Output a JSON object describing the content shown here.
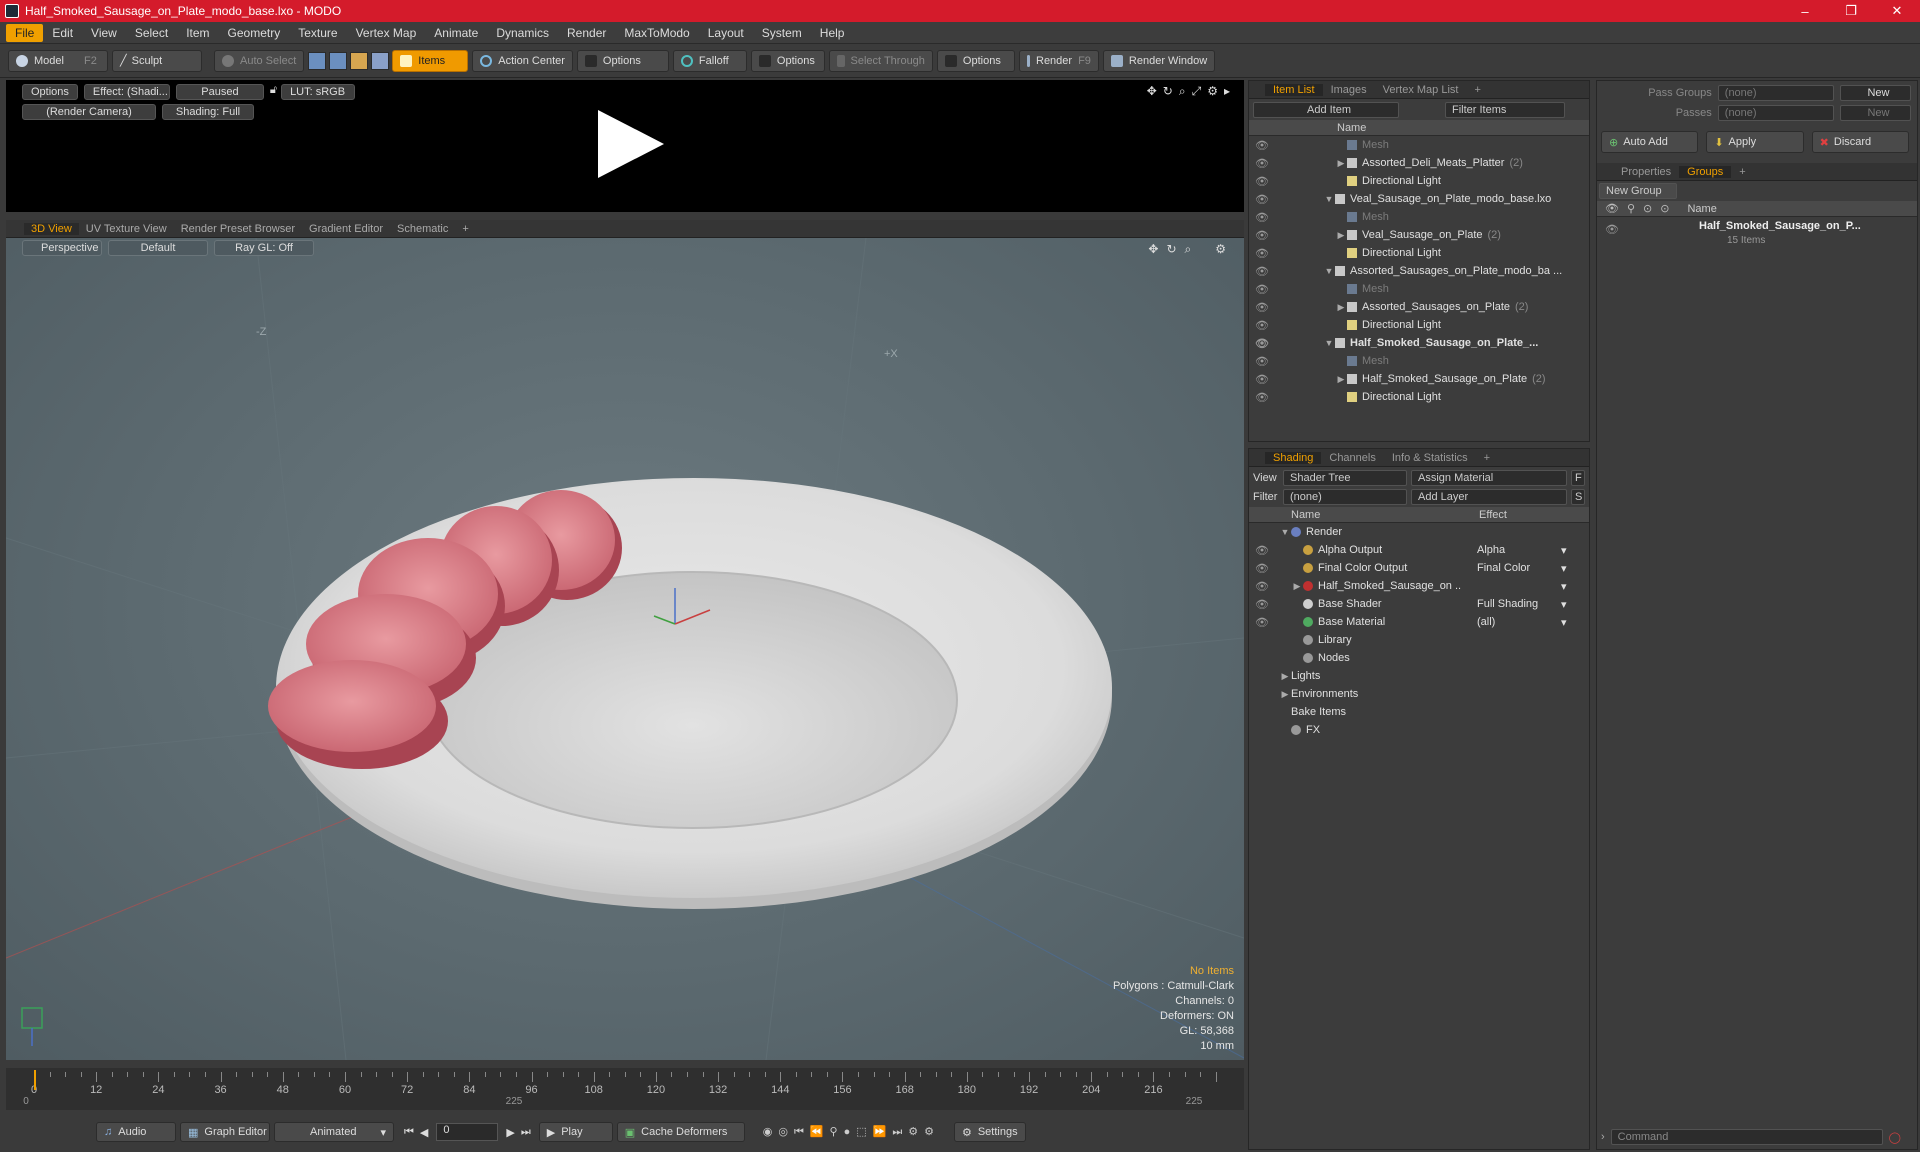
{
  "window": {
    "title": "Half_Smoked_Sausage_on_Plate_modo_base.lxo - MODO",
    "minimize": "–",
    "restore": "❐",
    "close": "✕"
  },
  "menu": [
    "File",
    "Edit",
    "View",
    "Select",
    "Item",
    "Geometry",
    "Texture",
    "Vertex Map",
    "Animate",
    "Dynamics",
    "Render",
    "MaxToModo",
    "Layout",
    "System",
    "Help"
  ],
  "toolbar": {
    "model": "Model",
    "model_key": "F2",
    "sculpt": "Sculpt",
    "auto_select": "Auto Select",
    "items": "Items",
    "action_center": "Action Center",
    "options1": "Options",
    "falloff": "Falloff",
    "options2": "Options",
    "select_through": "Select Through",
    "options3": "Options",
    "render": "Render",
    "render_key": "F9",
    "render_window": "Render Window"
  },
  "render_preview": {
    "options": "Options",
    "effect": "Effect: (Shadi...",
    "paused": "Paused",
    "lut": "LUT: sRGB",
    "camera": "(Render Camera)",
    "shading": "Shading: Full"
  },
  "viewport_tabs": [
    "3D View",
    "UV Texture View",
    "Render Preset Browser",
    "Gradient Editor",
    "Schematic",
    "+"
  ],
  "viewport": {
    "perspective": "Perspective",
    "default": "Default",
    "raygl": "Ray GL: Off",
    "axis_z": "-Z",
    "axis_x": "+X",
    "info": {
      "no_items": "No Items",
      "polygons": "Polygons : Catmull-Clark",
      "channels": "Channels: 0",
      "deformers": "Deformers: ON",
      "gl": "GL: 58,368",
      "unit": "10 mm"
    }
  },
  "timeline": {
    "ticks": [
      "0",
      "12",
      "24",
      "36",
      "48",
      "60",
      "72",
      "84",
      "96",
      "108",
      "120",
      "132",
      "144",
      "156",
      "168",
      "180",
      "192",
      "204",
      "216"
    ],
    "sub_left": "0",
    "sub_mid": "225",
    "sub_right": "225"
  },
  "bottombar": {
    "audio": "Audio",
    "graph_editor": "Graph Editor",
    "animated": "Animated",
    "frame": "0",
    "play": "Play",
    "cache": "Cache Deformers",
    "settings": "Settings"
  },
  "item_list": {
    "tabs": [
      "Item List",
      "Images",
      "Vertex Map List",
      "+"
    ],
    "add_item": "Add Item",
    "filter_items": "Filter Items",
    "col_name": "Name",
    "rows": [
      {
        "label": "Mesh",
        "dim": true,
        "indent": 1
      },
      {
        "label": "Assorted_Deli_Meats_Platter",
        "count": "(2)",
        "indent": 1,
        "arrow": "▶"
      },
      {
        "label": "Directional Light",
        "indent": 1
      },
      {
        "label": "Veal_Sausage_on_Plate_modo_base.lxo",
        "indent": 0,
        "arrow": "▼"
      },
      {
        "label": "Mesh",
        "dim": true,
        "indent": 1
      },
      {
        "label": "Veal_Sausage_on_Plate",
        "count": "(2)",
        "indent": 1,
        "arrow": "▶"
      },
      {
        "label": "Directional Light",
        "indent": 1
      },
      {
        "label": "Assorted_Sausages_on_Plate_modo_ba ...",
        "indent": 0,
        "arrow": "▼"
      },
      {
        "label": "Mesh",
        "dim": true,
        "indent": 1
      },
      {
        "label": "Assorted_Sausages_on_Plate",
        "count": "(2)",
        "indent": 1,
        "arrow": "▶"
      },
      {
        "label": "Directional Light",
        "indent": 1
      },
      {
        "label": "Half_Smoked_Sausage_on_Plate_...",
        "indent": 0,
        "arrow": "▼",
        "bold": true
      },
      {
        "label": "Mesh",
        "dim": true,
        "indent": 1
      },
      {
        "label": "Half_Smoked_Sausage_on_Plate",
        "count": "(2)",
        "indent": 1,
        "arrow": "▶"
      },
      {
        "label": "Directional Light",
        "indent": 1
      }
    ]
  },
  "shading": {
    "tabs": [
      "Shading",
      "Channels",
      "Info & Statistics",
      "+"
    ],
    "view_label": "View",
    "view_value": "Shader Tree",
    "assign_material": "Assign Material",
    "f": "F",
    "filter_label": "Filter",
    "filter_value": "(none)",
    "add_layer": "Add Layer",
    "s": "S",
    "col_name": "Name",
    "col_effect": "Effect",
    "rows": [
      {
        "label": "Render",
        "effect": "",
        "indent": 0,
        "arrow": "▼",
        "icon": "#6a7fc0"
      },
      {
        "label": "Alpha Output",
        "effect": "Alpha",
        "indent": 1,
        "icon": "#c8a040"
      },
      {
        "label": "Final Color Output",
        "effect": "Final Color",
        "indent": 1,
        "icon": "#c8a040"
      },
      {
        "label": "Half_Smoked_Sausage_on ...",
        "effect": "",
        "indent": 1,
        "arrow": "▶",
        "icon": "#c03030"
      },
      {
        "label": "Base Shader",
        "effect": "Full Shading",
        "indent": 1,
        "icon": "#cfcfcf"
      },
      {
        "label": "Base Material",
        "effect": "(all)",
        "indent": 1,
        "icon": "#4faa60"
      },
      {
        "label": "Library",
        "effect": "",
        "indent": 1,
        "icon": "#999"
      },
      {
        "label": "Nodes",
        "effect": "",
        "indent": 1,
        "icon": "#999"
      },
      {
        "label": "Lights",
        "effect": "",
        "indent": 0,
        "arrow": "▶"
      },
      {
        "label": "Environments",
        "effect": "",
        "indent": 0,
        "arrow": "▶"
      },
      {
        "label": "Bake Items",
        "effect": "",
        "indent": 0
      },
      {
        "label": "FX",
        "effect": "",
        "indent": 0,
        "icon": "#999"
      }
    ]
  },
  "groups": {
    "pass_groups": "Pass Groups",
    "pass_value": "(none)",
    "new": "New",
    "passes": "Passes",
    "passes_value": "(none)",
    "new2": "New",
    "auto_add": "Auto Add",
    "apply": "Apply",
    "discard": "Discard",
    "tabs": [
      "Properties",
      "Groups",
      "+"
    ],
    "new_group": "New Group",
    "col_name": "Name",
    "group_name": "Half_Smoked_Sausage_on_P...",
    "group_count": "15 Items",
    "command": "Command"
  }
}
